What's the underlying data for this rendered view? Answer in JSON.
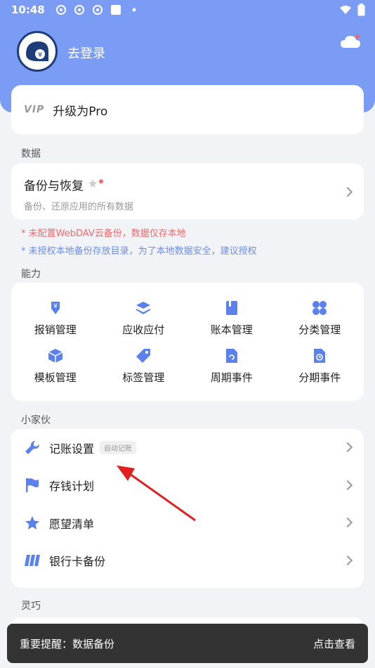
{
  "status": {
    "time": "10:48"
  },
  "profile": {
    "login_text": "去登录"
  },
  "pro": {
    "vip_text": "VIP",
    "label": "升级为Pro"
  },
  "sections": {
    "data": "数据",
    "ability": "能力",
    "tools": "小家伙",
    "smart": "灵巧"
  },
  "backup": {
    "title": "备份与恢复",
    "subtitle": "备份、还原应用的所有数据"
  },
  "warnings": {
    "webdav": "* 未配置WebDAV云备份，数据仅存本地",
    "local": "* 未授权本地备份存放目录，为了本地数据安全，建议授权"
  },
  "grid": [
    {
      "label": "报销管理",
      "icon": "reimburse-icon"
    },
    {
      "label": "应收应付",
      "icon": "layers-icon"
    },
    {
      "label": "账本管理",
      "icon": "book-icon"
    },
    {
      "label": "分类管理",
      "icon": "category-icon"
    },
    {
      "label": "模板管理",
      "icon": "template-icon"
    },
    {
      "label": "标签管理",
      "icon": "tag-icon"
    },
    {
      "label": "周期事件",
      "icon": "cycle-icon"
    },
    {
      "label": "分期事件",
      "icon": "installment-icon"
    }
  ],
  "list": [
    {
      "label": "记账设置",
      "badge": "自动记账",
      "icon": "wrench-icon"
    },
    {
      "label": "存钱计划",
      "icon": "flag-icon"
    },
    {
      "label": "愿望清单",
      "icon": "star-icon"
    },
    {
      "label": "银行卡备份",
      "icon": "card-icon"
    }
  ],
  "toast": {
    "message": "重要提醒：数据备份",
    "action": "点击查看"
  },
  "colors": {
    "accent": "#7b9cf5",
    "icon": "#5b82ec",
    "warn_red": "#ef6a6a",
    "warn_blue": "#6b8df2",
    "arrow": "#e02020"
  }
}
